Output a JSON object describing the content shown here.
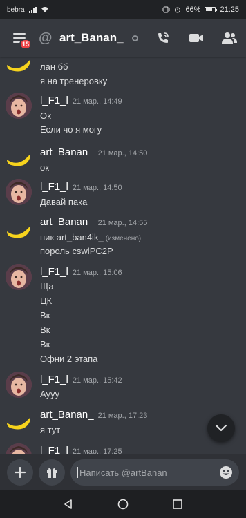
{
  "status_bar": {
    "carrier": "bebra",
    "battery": "66%",
    "time": "21:25"
  },
  "header": {
    "at_symbol": "@",
    "channel_name": "art_Banan_",
    "badge_count": "15"
  },
  "messages": [
    {
      "author": "",
      "timestamp": "",
      "avatar": "banana",
      "lines": [
        "лан бб",
        "я на тренеровку"
      ]
    },
    {
      "author": "l_F1_l",
      "timestamp": "21 мар., 14:49",
      "avatar": "girl",
      "lines": [
        "Ок",
        "Если чо я могу"
      ]
    },
    {
      "author": "art_Banan_",
      "timestamp": "21 мар., 14:50",
      "avatar": "banana",
      "lines": [
        "ок"
      ]
    },
    {
      "author": "l_F1_l",
      "timestamp": "21 мар., 14:50",
      "avatar": "girl",
      "lines": [
        "Давай пака"
      ]
    },
    {
      "author": "art_Banan_",
      "timestamp": "21 мар., 14:55",
      "avatar": "banana",
      "lines": [
        "ник art_ban4ik_",
        "пороль cswlPC2P"
      ],
      "edited_label": "(изменено)"
    },
    {
      "author": "l_F1_l",
      "timestamp": "21 мар., 15:06",
      "avatar": "girl",
      "lines": [
        "Ща",
        "ЦК",
        "Вк",
        "Вк",
        "Вк",
        "Офни 2 этапа"
      ]
    },
    {
      "author": "l_F1_l",
      "timestamp": "21 мар., 15:42",
      "avatar": "girl",
      "lines": [
        "Аууу"
      ]
    },
    {
      "author": "art_Banan_",
      "timestamp": "21 мар., 17:23",
      "avatar": "banana",
      "lines": [
        "я тут"
      ]
    },
    {
      "author": "l_F1_l",
      "timestamp": "21 мар., 17:25",
      "avatar": "girl",
      "lines": []
    }
  ],
  "composer": {
    "placeholder": "Написать @artBanan"
  },
  "colors": {
    "background": "#36393f",
    "input_bar": "#2f3136",
    "badge": "#ed4245",
    "banana": "#f6d31d"
  }
}
